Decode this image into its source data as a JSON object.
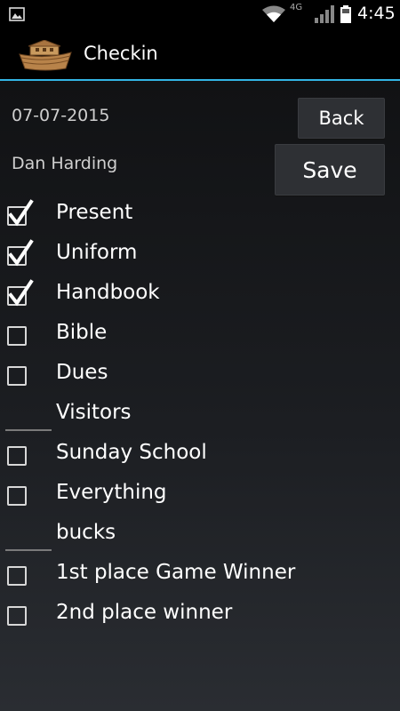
{
  "statusbar": {
    "network_label": "4G",
    "time": "4:45"
  },
  "actionbar": {
    "title": "Checkin"
  },
  "header": {
    "date": "07-07-2015",
    "member_name": "Dan Harding",
    "back_label": "Back",
    "save_label": "Save"
  },
  "items": [
    {
      "label": "Present",
      "type": "checkbox",
      "checked": true
    },
    {
      "label": "Uniform",
      "type": "checkbox",
      "checked": true
    },
    {
      "label": "Handbook",
      "type": "checkbox",
      "checked": true
    },
    {
      "label": "Bible",
      "type": "checkbox",
      "checked": false
    },
    {
      "label": "Dues",
      "type": "checkbox",
      "checked": false
    },
    {
      "label": "Visitors",
      "type": "input",
      "value": ""
    },
    {
      "label": "Sunday School",
      "type": "checkbox",
      "checked": false
    },
    {
      "label": "Everything",
      "type": "checkbox",
      "checked": false
    },
    {
      "label": "bucks",
      "type": "input",
      "value": ""
    },
    {
      "label": "1st place Game Winner",
      "type": "checkbox",
      "checked": false
    },
    {
      "label": "2nd place winner",
      "type": "checkbox",
      "checked": false
    }
  ],
  "colors": {
    "accent": "#33b5e5",
    "background": "#1c1e22",
    "button": "#2e3034"
  }
}
